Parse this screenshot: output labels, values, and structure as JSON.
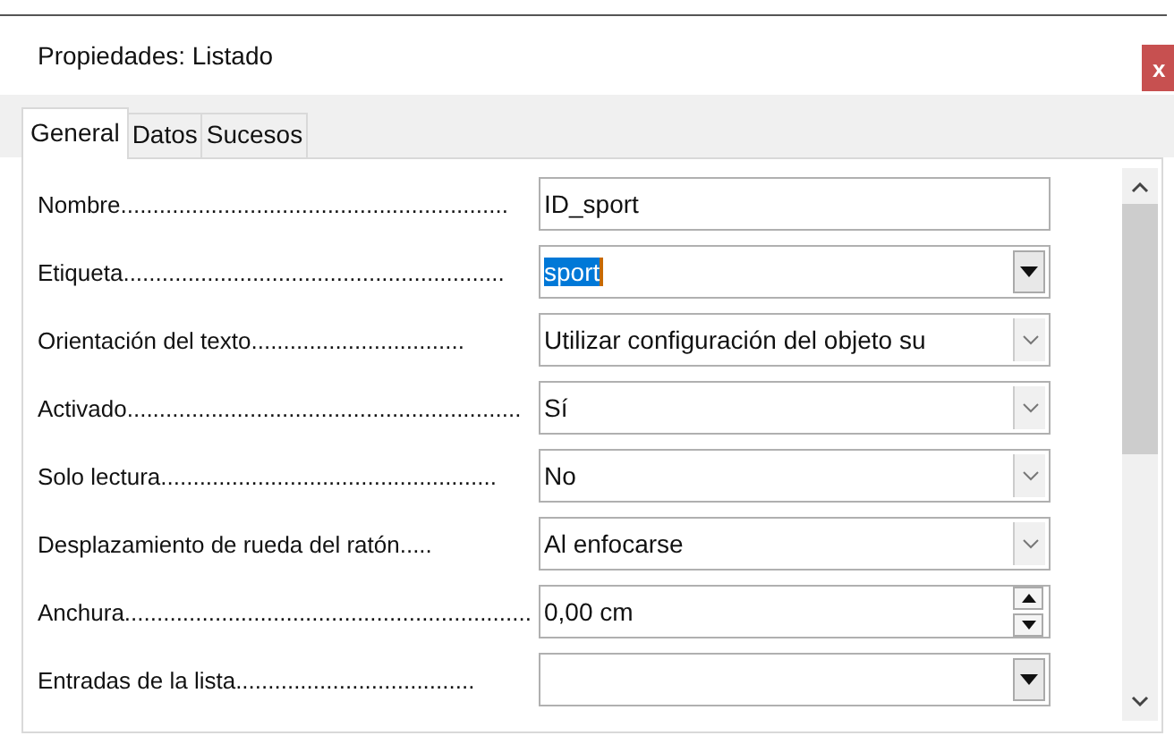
{
  "window": {
    "title": "Propiedades: Listado",
    "close": "x"
  },
  "tabs": [
    {
      "label": "General",
      "selected": true
    },
    {
      "label": "Datos",
      "selected": false
    },
    {
      "label": "Sucesos",
      "selected": false
    }
  ],
  "properties": [
    {
      "label": "Nombre............................................................",
      "kind": "text",
      "value": "ID_sport"
    },
    {
      "label": "Etiqueta...........................................................",
      "kind": "combo",
      "value": "sport",
      "highlighted": true
    },
    {
      "label": "Orientación del texto.................................",
      "kind": "select",
      "value": "Utilizar configuración del objeto su"
    },
    {
      "label": "Activado.............................................................",
      "kind": "select",
      "value": "Sí"
    },
    {
      "label": "Solo lectura....................................................",
      "kind": "select",
      "value": "No"
    },
    {
      "label": "Desplazamiento de rueda del ratón.....",
      "kind": "select",
      "value": "Al enfocarse"
    },
    {
      "label": "Anchura...............................................................",
      "kind": "spin",
      "value": "0,00 cm"
    },
    {
      "label": "Entradas de la lista.....................................",
      "kind": "combo"
    }
  ]
}
